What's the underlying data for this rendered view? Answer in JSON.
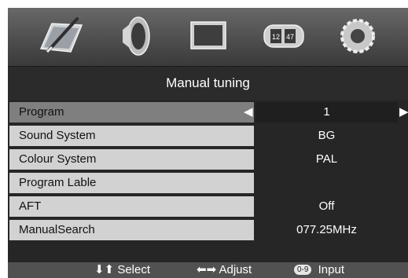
{
  "menu_icons": [
    {
      "name": "picture-icon"
    },
    {
      "name": "sound-icon"
    },
    {
      "name": "screen-icon"
    },
    {
      "name": "clock-icon",
      "digits_left": "12",
      "digits_right": "47"
    },
    {
      "name": "setup-gear-icon"
    }
  ],
  "title": "Manual tuning",
  "rows": [
    {
      "label": "Program",
      "value": "1"
    },
    {
      "label": "Sound System",
      "value": "BG"
    },
    {
      "label": "Colour System",
      "value": "PAL"
    },
    {
      "label": "Program Lable",
      "value": ""
    },
    {
      "label": "AFT",
      "value": "Off"
    },
    {
      "label": "ManualSearch",
      "value": "077.25MHz"
    }
  ],
  "footer": {
    "select_glyph": "⬇⬆",
    "select_label": "Select",
    "adjust_glyph": "⬅➡",
    "adjust_label": "Adjust",
    "input_key": "0-9",
    "input_label": "Input"
  },
  "colors": {
    "label_bg": "#d2d2d2",
    "selected_label_bg": "#7f7f7f",
    "value_bg": "#262626"
  }
}
